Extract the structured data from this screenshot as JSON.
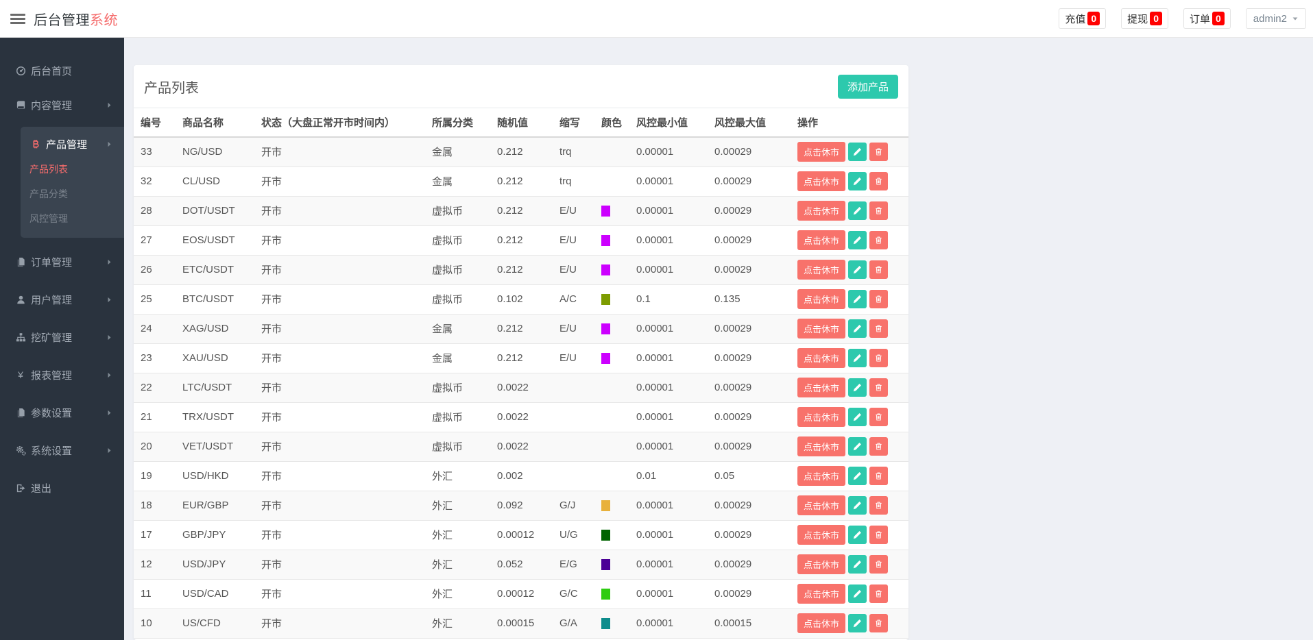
{
  "header": {
    "brand": {
      "part1": "后台管理",
      "part2": "系统"
    },
    "actions": [
      {
        "id": "recharge",
        "label": "充值",
        "badge": "0"
      },
      {
        "id": "withdraw",
        "label": "提现",
        "badge": "0"
      },
      {
        "id": "orders",
        "label": "订单",
        "badge": "0"
      }
    ],
    "user": {
      "name": "admin2"
    }
  },
  "sidebar": {
    "items": [
      {
        "id": "dashboard",
        "label": "后台首页",
        "icon": "dashboard-icon",
        "chevron": false
      },
      {
        "id": "content",
        "label": "内容管理",
        "icon": "book-icon",
        "chevron": true
      },
      {
        "id": "product",
        "label": "产品管理",
        "icon": "bitcoin-icon",
        "chevron": true,
        "active": true,
        "children": [
          {
            "id": "product-list",
            "label": "产品列表",
            "active": true
          },
          {
            "id": "product-category",
            "label": "产品分类"
          },
          {
            "id": "risk-control",
            "label": "风控管理"
          }
        ]
      },
      {
        "id": "order",
        "label": "订单管理",
        "icon": "files-icon",
        "chevron": true
      },
      {
        "id": "user",
        "label": "用户管理",
        "icon": "user-icon",
        "chevron": true
      },
      {
        "id": "mining",
        "label": "挖矿管理",
        "icon": "sitemap-icon",
        "chevron": true
      },
      {
        "id": "report",
        "label": "报表管理",
        "icon": "yen-icon",
        "chevron": true
      },
      {
        "id": "params",
        "label": "参数设置",
        "icon": "files-icon",
        "chevron": true
      },
      {
        "id": "system",
        "label": "系统设置",
        "icon": "gears-icon",
        "chevron": true
      },
      {
        "id": "logout",
        "label": "退出",
        "icon": "signout-icon",
        "chevron": false
      }
    ]
  },
  "main": {
    "title": "产品列表",
    "add_button": "添加产品",
    "table": {
      "columns": [
        "编号",
        "商品名称",
        "状态（大盘正常开市时间内）",
        "所属分类",
        "随机值",
        "缩写",
        "颜色",
        "风控最小值",
        "风控最大值",
        "操作"
      ],
      "action_labels": {
        "toggle": "点击休市",
        "edit_icon": "pencil-icon",
        "delete_icon": "trash-icon"
      },
      "rows": [
        {
          "id": "33",
          "name": "NG/USD",
          "status": "开市",
          "category": "金属",
          "random": "0.212",
          "abbr": "trq",
          "color": "",
          "risk_min": "0.00001",
          "risk_max": "0.00029"
        },
        {
          "id": "32",
          "name": "CL/USD",
          "status": "开市",
          "category": "金属",
          "random": "0.212",
          "abbr": "trq",
          "color": "",
          "risk_min": "0.00001",
          "risk_max": "0.00029"
        },
        {
          "id": "28",
          "name": "DOT/USDT",
          "status": "开市",
          "category": "虚拟币",
          "random": "0.212",
          "abbr": "E/U",
          "color": "#cc00ff",
          "risk_min": "0.00001",
          "risk_max": "0.00029"
        },
        {
          "id": "27",
          "name": "EOS/USDT",
          "status": "开市",
          "category": "虚拟币",
          "random": "0.212",
          "abbr": "E/U",
          "color": "#cc00ff",
          "risk_min": "0.00001",
          "risk_max": "0.00029"
        },
        {
          "id": "26",
          "name": "ETC/USDT",
          "status": "开市",
          "category": "虚拟币",
          "random": "0.212",
          "abbr": "E/U",
          "color": "#cc00ff",
          "risk_min": "0.00001",
          "risk_max": "0.00029"
        },
        {
          "id": "25",
          "name": "BTC/USDT",
          "status": "开市",
          "category": "虚拟币",
          "random": "0.102",
          "abbr": "A/C",
          "color": "#7d9c00",
          "risk_min": "0.1",
          "risk_max": "0.135"
        },
        {
          "id": "24",
          "name": "XAG/USD",
          "status": "开市",
          "category": "金属",
          "random": "0.212",
          "abbr": "E/U",
          "color": "#cc00ff",
          "risk_min": "0.00001",
          "risk_max": "0.00029"
        },
        {
          "id": "23",
          "name": "XAU/USD",
          "status": "开市",
          "category": "金属",
          "random": "0.212",
          "abbr": "E/U",
          "color": "#cc00ff",
          "risk_min": "0.00001",
          "risk_max": "0.00029"
        },
        {
          "id": "22",
          "name": "LTC/USDT",
          "status": "开市",
          "category": "虚拟币",
          "random": "0.0022",
          "abbr": "",
          "color": "",
          "risk_min": "0.00001",
          "risk_max": "0.00029"
        },
        {
          "id": "21",
          "name": "TRX/USDT",
          "status": "开市",
          "category": "虚拟币",
          "random": "0.0022",
          "abbr": "",
          "color": "",
          "risk_min": "0.00001",
          "risk_max": "0.00029"
        },
        {
          "id": "20",
          "name": "VET/USDT",
          "status": "开市",
          "category": "虚拟币",
          "random": "0.0022",
          "abbr": "",
          "color": "",
          "risk_min": "0.00001",
          "risk_max": "0.00029"
        },
        {
          "id": "19",
          "name": "USD/HKD",
          "status": "开市",
          "category": "外汇",
          "random": "0.002",
          "abbr": "",
          "color": "",
          "risk_min": "0.01",
          "risk_max": "0.05"
        },
        {
          "id": "18",
          "name": "EUR/GBP",
          "status": "开市",
          "category": "外汇",
          "random": "0.092",
          "abbr": "G/J",
          "color": "#e8b13c",
          "risk_min": "0.00001",
          "risk_max": "0.00029"
        },
        {
          "id": "17",
          "name": "GBP/JPY",
          "status": "开市",
          "category": "外汇",
          "random": "0.00012",
          "abbr": "U/G",
          "color": "#006400",
          "risk_min": "0.00001",
          "risk_max": "0.00029"
        },
        {
          "id": "12",
          "name": "USD/JPY",
          "status": "开市",
          "category": "外汇",
          "random": "0.052",
          "abbr": "E/G",
          "color": "#4b0096",
          "risk_min": "0.00001",
          "risk_max": "0.00029"
        },
        {
          "id": "11",
          "name": "USD/CAD",
          "status": "开市",
          "category": "外汇",
          "random": "0.00012",
          "abbr": "G/C",
          "color": "#2ecc11",
          "risk_min": "0.00001",
          "risk_max": "0.00029"
        },
        {
          "id": "10",
          "name": "US/CFD",
          "status": "开市",
          "category": "外汇",
          "random": "0.00015",
          "abbr": "G/A",
          "color": "#0e8c8c",
          "risk_min": "0.00001",
          "risk_max": "0.00015"
        }
      ]
    }
  },
  "colors": {
    "accent_red": "#f56c6c",
    "button_teal": "#2dc9ad",
    "button_salmon": "#f8726b",
    "badge_red": "#ff0000",
    "sidebar_bg": "#2a333e",
    "sidebar_group_bg": "#3a4450",
    "body_bg": "#eef0f5"
  }
}
